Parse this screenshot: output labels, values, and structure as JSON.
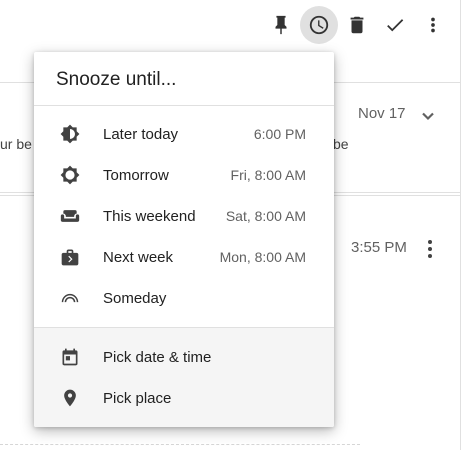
{
  "toolbar": {
    "icons": [
      "pin-icon",
      "clock-icon",
      "trash-icon",
      "check-icon",
      "more-vert-icon"
    ]
  },
  "background": {
    "row1": {
      "date": "Nov 17",
      "snippet_left": "ur be",
      "snippet_right": "be"
    },
    "row2": {
      "time": "3:55 PM"
    }
  },
  "snooze_menu": {
    "title": "Snooze until...",
    "options": [
      {
        "label": "Later today",
        "time": "6:00 PM",
        "icon": "later-today-icon"
      },
      {
        "label": "Tomorrow",
        "time": "Fri, 8:00 AM",
        "icon": "tomorrow-icon"
      },
      {
        "label": "This weekend",
        "time": "Sat, 8:00 AM",
        "icon": "weekend-icon"
      },
      {
        "label": "Next week",
        "time": "Mon, 8:00 AM",
        "icon": "next-week-icon"
      },
      {
        "label": "Someday",
        "time": "",
        "icon": "someday-icon"
      }
    ],
    "pick_options": [
      {
        "label": "Pick date & time",
        "icon": "calendar-icon"
      },
      {
        "label": "Pick place",
        "icon": "place-icon"
      }
    ]
  },
  "colors": {
    "active_button_bg": "#e0e0e0",
    "icon": "#424242",
    "menu_lower_bg": "#f5f5f5"
  }
}
